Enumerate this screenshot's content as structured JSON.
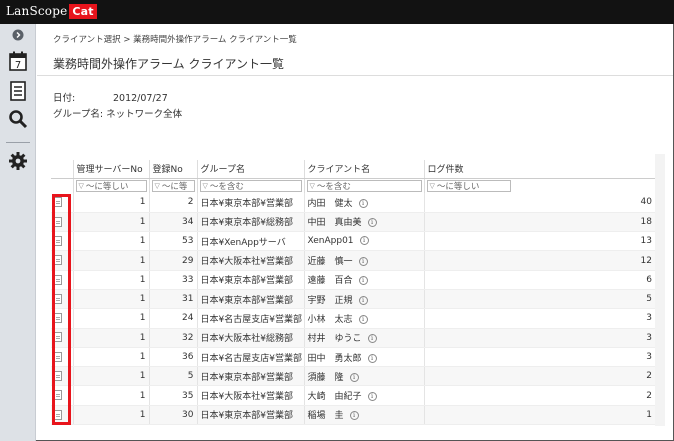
{
  "app": {
    "logo_main": "LanScope",
    "logo_cat": "Cat"
  },
  "sidebar": {
    "calendar_day": "7",
    "icons": [
      "expand-icon",
      "calendar-icon",
      "report-icon",
      "search-icon",
      "gear-icon"
    ]
  },
  "breadcrumb": "クライアント選択 > 業務時間外操作アラーム クライアント一覧",
  "page_title": "業務時間外操作アラーム クライアント一覧",
  "meta": {
    "date_label": "日付:",
    "date_value": "2012/07/27",
    "group_label": "グループ名:",
    "group_value": "ネットワーク全体"
  },
  "table": {
    "columns": [
      "",
      "管理サーバーNo",
      "登録No",
      "グループ名",
      "クライアント名",
      "ログ件数"
    ],
    "filters": [
      "",
      "～に等しい",
      "～に等",
      "～を含む",
      "～を含む",
      "～に等しい"
    ],
    "filter_icon": "▽",
    "info_glyph": "i",
    "rows": [
      {
        "server": "1",
        "reg": "2",
        "group": "日本¥東京本部¥営業部",
        "client": "内田　健太",
        "logs": "40"
      },
      {
        "server": "1",
        "reg": "34",
        "group": "日本¥東京本部¥総務部",
        "client": "中田　真由美",
        "logs": "18"
      },
      {
        "server": "1",
        "reg": "53",
        "group": "日本¥XenAppサーバ",
        "client": "XenApp01",
        "logs": "13"
      },
      {
        "server": "1",
        "reg": "29",
        "group": "日本¥大阪本社¥営業部",
        "client": "近藤　慎一",
        "logs": "12"
      },
      {
        "server": "1",
        "reg": "33",
        "group": "日本¥東京本部¥営業部",
        "client": "遠藤　百合",
        "logs": "6"
      },
      {
        "server": "1",
        "reg": "31",
        "group": "日本¥東京本部¥営業部",
        "client": "宇野　正規",
        "logs": "5"
      },
      {
        "server": "1",
        "reg": "24",
        "group": "日本¥名古屋支店¥営業部",
        "client": "小林　太志",
        "logs": "3"
      },
      {
        "server": "1",
        "reg": "32",
        "group": "日本¥大阪本社¥総務部",
        "client": "村井　ゆうこ",
        "logs": "3"
      },
      {
        "server": "1",
        "reg": "36",
        "group": "日本¥名古屋支店¥営業部",
        "client": "田中　勇太郎",
        "logs": "3"
      },
      {
        "server": "1",
        "reg": "5",
        "group": "日本¥東京本部¥営業部",
        "client": "須藤　隆",
        "logs": "2"
      },
      {
        "server": "1",
        "reg": "35",
        "group": "日本¥大阪本社¥営業部",
        "client": "大崎　由紀子",
        "logs": "2"
      },
      {
        "server": "1",
        "reg": "30",
        "group": "日本¥東京本部¥営業部",
        "client": "稲場　圭",
        "logs": "1"
      }
    ]
  },
  "colors": {
    "accent": "#e8141c",
    "topbar": "#121212",
    "sidebar": "#dde1e6"
  }
}
